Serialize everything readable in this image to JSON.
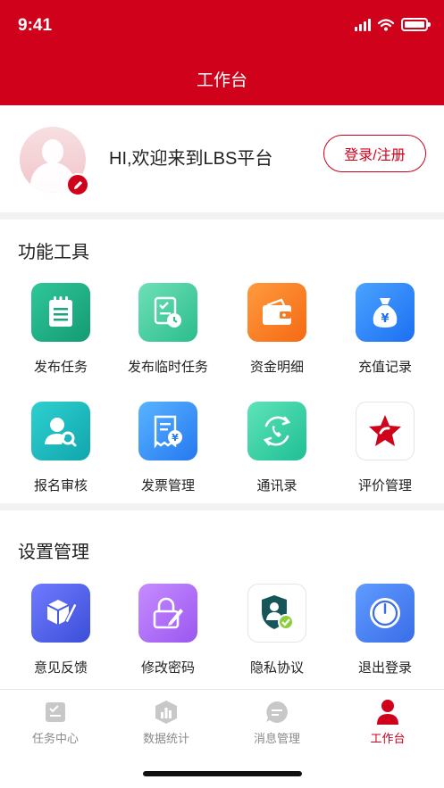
{
  "status_bar": {
    "time": "9:41"
  },
  "nav": {
    "title": "工作台"
  },
  "profile": {
    "welcome": "HI,欢迎来到LBS平台",
    "login_label": "登录/注册"
  },
  "tools": {
    "title": "功能工具",
    "items": [
      {
        "label": "发布任务",
        "icon": "notepad-icon"
      },
      {
        "label": "发布临时任务",
        "icon": "task-clock-icon"
      },
      {
        "label": "资金明细",
        "icon": "wallet-icon"
      },
      {
        "label": "充值记录",
        "icon": "money-bag-icon"
      },
      {
        "label": "报名审核",
        "icon": "user-search-icon"
      },
      {
        "label": "发票管理",
        "icon": "invoice-icon"
      },
      {
        "label": "通讯录",
        "icon": "phone-sync-icon"
      },
      {
        "label": "评价管理",
        "icon": "star-icon"
      }
    ]
  },
  "settings": {
    "title": "设置管理",
    "items": [
      {
        "label": "意见反馈",
        "icon": "feedback-cube-icon"
      },
      {
        "label": "修改密码",
        "icon": "lock-edit-icon"
      },
      {
        "label": "隐私协议",
        "icon": "privacy-shield-icon"
      },
      {
        "label": "退出登录",
        "icon": "power-icon"
      }
    ]
  },
  "tabbar": {
    "items": [
      {
        "label": "任务中心",
        "icon": "task-center-icon",
        "active": false
      },
      {
        "label": "数据统计",
        "icon": "statistics-icon",
        "active": false
      },
      {
        "label": "消息管理",
        "icon": "message-icon",
        "active": false
      },
      {
        "label": "工作台",
        "icon": "workbench-user-icon",
        "active": true
      }
    ]
  },
  "colors": {
    "brand": "#d0021b",
    "inactive": "#8a8a8a"
  }
}
